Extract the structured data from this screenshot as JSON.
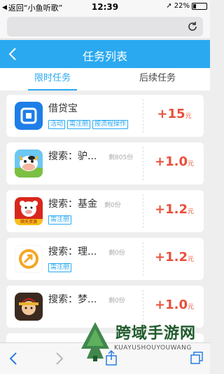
{
  "status_bar": {
    "back_label": "返回“小鱼听歌”",
    "time": "12:39",
    "battery": "22%",
    "battery_level": 0.22
  },
  "header": {
    "title": "任务列表"
  },
  "tabs": [
    {
      "label": "限时任务",
      "active": true
    },
    {
      "label": "后续任务",
      "active": false
    }
  ],
  "tasks": [
    {
      "name": "借贷宝",
      "remaining": "",
      "tags": [
        "活动",
        "需注册",
        "按流程操作"
      ],
      "reward": "+15",
      "unit": "元",
      "icon": "jiedaibao-app-icon"
    },
    {
      "name": "搜索：驴...",
      "remaining": "剩805份",
      "tags": [],
      "reward": "+1.0",
      "unit": "元",
      "icon": "cow-app-icon"
    },
    {
      "name": "搜索：基金",
      "remaining": "剩0份",
      "tags": [
        "需注册"
      ],
      "reward": "+1.2",
      "unit": "元",
      "icon": "fund-app-icon"
    },
    {
      "name": "搜索：理...",
      "remaining": "剩0份",
      "tags": [
        "需注册"
      ],
      "reward": "+1.2",
      "unit": "元",
      "icon": "finance-app-icon"
    },
    {
      "name": "搜索：梦...",
      "remaining": "剩0份",
      "tags": [],
      "reward": "+1.0",
      "unit": "元",
      "icon": "game-app-icon"
    }
  ],
  "fund_icon_badge": "顺天资源",
  "watermark": {
    "title": "跨域手游网",
    "subtitle": "KUAYUSHOUYOUWANG"
  },
  "colors": {
    "accent": "#2aa9f0",
    "reward": "#e8503b"
  }
}
